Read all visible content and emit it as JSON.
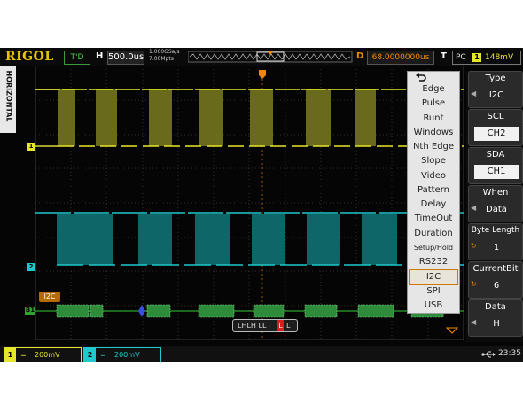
{
  "colors": {
    "ch1": "#e6e62a",
    "ch2": "#1fc8cc",
    "bus": "#2fa52f",
    "accent": "#f08a00"
  },
  "topbar": {
    "brand": "RIGOL",
    "run_state": "T'D",
    "h_label": "H",
    "timebase": "500.0us",
    "sample_rate": "1.000GSa/s",
    "memory_depth": "7.00Mpts",
    "d_label": "D",
    "delay": "68.0000000us",
    "t_label": "T",
    "trigger_type": "PC",
    "trigger_source": "1",
    "trigger_level": "148mV"
  },
  "side": {
    "horizontal_label": "HORIZONTAL"
  },
  "channels": {
    "ch1_marker": "1",
    "ch2_marker": "2",
    "bus_marker": "B1"
  },
  "decode": {
    "bus_tag": "I2C",
    "trigger_data": "LHLH LL",
    "trigger_data_highlight": "L",
    "trigger_data_tail": "L"
  },
  "menu": {
    "icon": "undo-arrow-icon",
    "items": [
      "Edge",
      "Pulse",
      "Runt",
      "Windows",
      "Nth Edge",
      "Slope",
      "Video",
      "Pattern",
      "Delay",
      "TimeOut",
      "Duration",
      "Setup/Hold",
      "RS232",
      "I2C",
      "SPI",
      "USB"
    ],
    "selected": "I2C"
  },
  "panel": {
    "keys": [
      {
        "label": "Type",
        "value": "I2C"
      },
      {
        "label": "SCL",
        "value": "CH2"
      },
      {
        "label": "SDA",
        "value": "CH1"
      },
      {
        "label": "When",
        "value": "Data"
      },
      {
        "label": "Byte Length",
        "value": "1"
      },
      {
        "label": "CurrentBit",
        "value": "6"
      },
      {
        "label": "Data",
        "value": "H"
      }
    ]
  },
  "bottom": {
    "ch1_num": "1",
    "ch1_coupling": "=",
    "ch1_scale": "200mV",
    "ch2_num": "2",
    "ch2_coupling": "=",
    "ch2_scale": "200mV",
    "usb_icon": "usb-icon",
    "time": "23:35"
  }
}
